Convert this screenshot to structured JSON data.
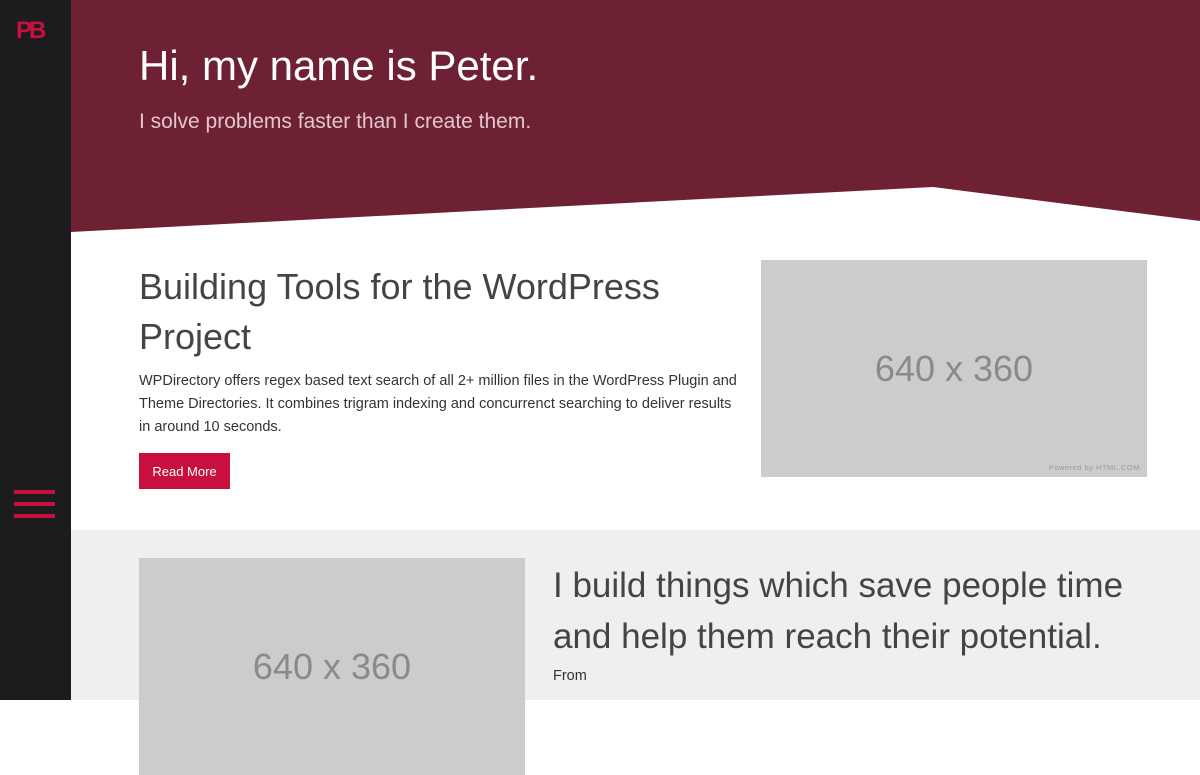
{
  "sidebar": {
    "logo": "PB",
    "menu_icon": "hamburger-menu-icon",
    "accent_color": "#c8103e",
    "background_color": "#1c1c1e"
  },
  "hero": {
    "title": "Hi, my name is Peter.",
    "subtitle": "I solve problems faster than I create them.",
    "background_color": "#6e2133"
  },
  "project": {
    "title": "Building Tools for the WordPress Project",
    "description": "WPDirectory offers regex based text search of all 2+ million files in the WordPress Plugin and Theme Directories. It combines trigram indexing and concurrenct searching to deliver results in around 10 seconds.",
    "button_label": "Read More",
    "image_label": "640 x 360",
    "image_credit": "Powered by HTML.COM"
  },
  "about": {
    "image_label": "640 x 360",
    "title": "I build things which save people time and help them reach their potential.",
    "body_start": "From",
    "background_color": "#f1efee"
  }
}
